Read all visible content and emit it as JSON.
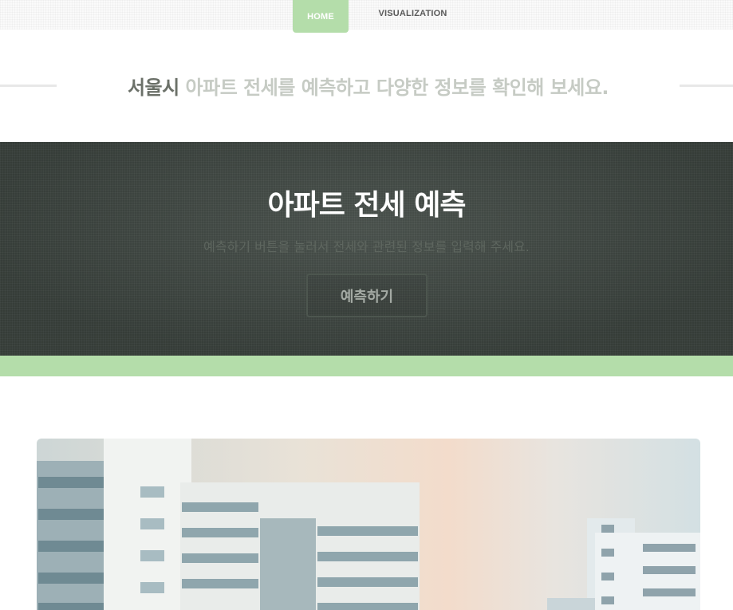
{
  "nav": {
    "items": [
      {
        "label": "HOME",
        "active": true
      },
      {
        "label": "VISUALIZATION",
        "active": false
      }
    ]
  },
  "tagline": {
    "strong": "서울시",
    "rest": " 아파트 전세를 예측하고 다양한 정보를 확인해 보세요."
  },
  "hero": {
    "title": "아파트 전세 예측",
    "subtitle": "예측하기 버튼을 눌러서 전세와 관련된 정보를 입력해 주세요.",
    "button_label": "예측하기"
  },
  "photo": {
    "icon": "apartment-buildings-image"
  },
  "colors": {
    "accent_green": "#b4ddaa",
    "hero_bg": "#3d4540"
  }
}
